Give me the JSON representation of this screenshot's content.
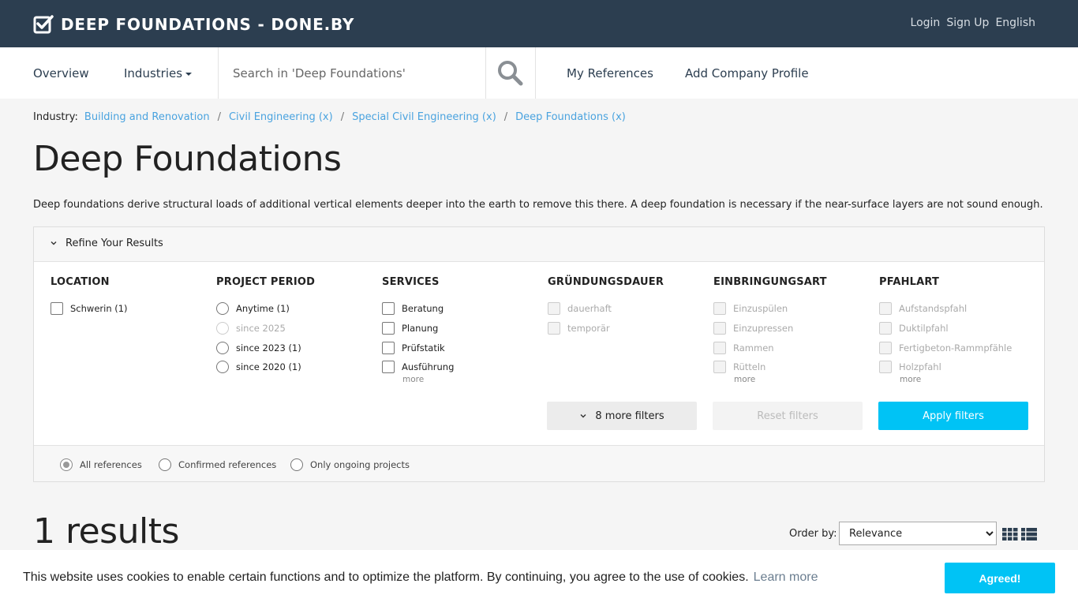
{
  "header": {
    "brand": "DEEP FOUNDATIONS - DONE.BY",
    "login": "Login",
    "signup": "Sign Up",
    "language": "English"
  },
  "nav": {
    "overview": "Overview",
    "industries": "Industries",
    "search_placeholder": "Search in 'Deep Foundations'",
    "my_references": "My References",
    "add_company": "Add Company Profile"
  },
  "breadcrumb": {
    "label": "Industry:",
    "items": [
      "Building and Renovation",
      "Civil Engineering (x)",
      "Special Civil Engineering (x)",
      "Deep Foundations (x)"
    ]
  },
  "page": {
    "title": "Deep Foundations",
    "description": "Deep foundations derive structural loads of additional vertical elements deeper into the earth to remove this there. A deep foundation is necessary if the near-surface layers are not sound enough."
  },
  "filters": {
    "title": "Refine Your Results",
    "location": {
      "title": "LOCATION",
      "options": [
        "Schwerin (1)"
      ]
    },
    "period": {
      "title": "PROJECT PERIOD",
      "options": [
        "Anytime (1)",
        "since 2025",
        "since 2023 (1)",
        "since 2020 (1)"
      ]
    },
    "services": {
      "title": "SERVICES",
      "options": [
        "Beratung",
        "Planung",
        "Prüfstatik",
        "Ausführung"
      ],
      "more": "more"
    },
    "dauer": {
      "title": "GRÜNDUNGSDAUER",
      "options": [
        "dauerhaft",
        "temporär"
      ]
    },
    "einbringung": {
      "title": "EINBRINGUNGSART",
      "options": [
        "Einzuspülen",
        "Einzupressen",
        "Rammen",
        "Rütteln"
      ],
      "more": "more"
    },
    "pfahlart": {
      "title": "PFAHLART",
      "options": [
        "Aufstandspfahl",
        "Duktilpfahl",
        "Fertigbeton-Rammpfähle",
        "Holzpfahl"
      ],
      "more": "more"
    },
    "more_filters": "8 more filters",
    "reset": "Reset filters",
    "apply": "Apply filters",
    "scope": [
      "All references",
      "Confirmed references",
      "Only ongoing projects"
    ]
  },
  "results": {
    "count": "1 results",
    "order_label": "Order by:",
    "order_value": "Relevance"
  },
  "cookie": {
    "text": "This website uses cookies to enable certain functions and to optimize the platform. By continuing, you agree to the use of cookies.",
    "link": "Learn more",
    "button": "Agreed!"
  },
  "colors": {
    "topbar": "#2c3e50",
    "link": "#4aa3df",
    "accent": "#00c3f5"
  },
  "icons": [
    "checkbox-logo-icon",
    "search-icon",
    "chevron-down-icon",
    "grid-view-icon",
    "list-view-icon"
  ]
}
